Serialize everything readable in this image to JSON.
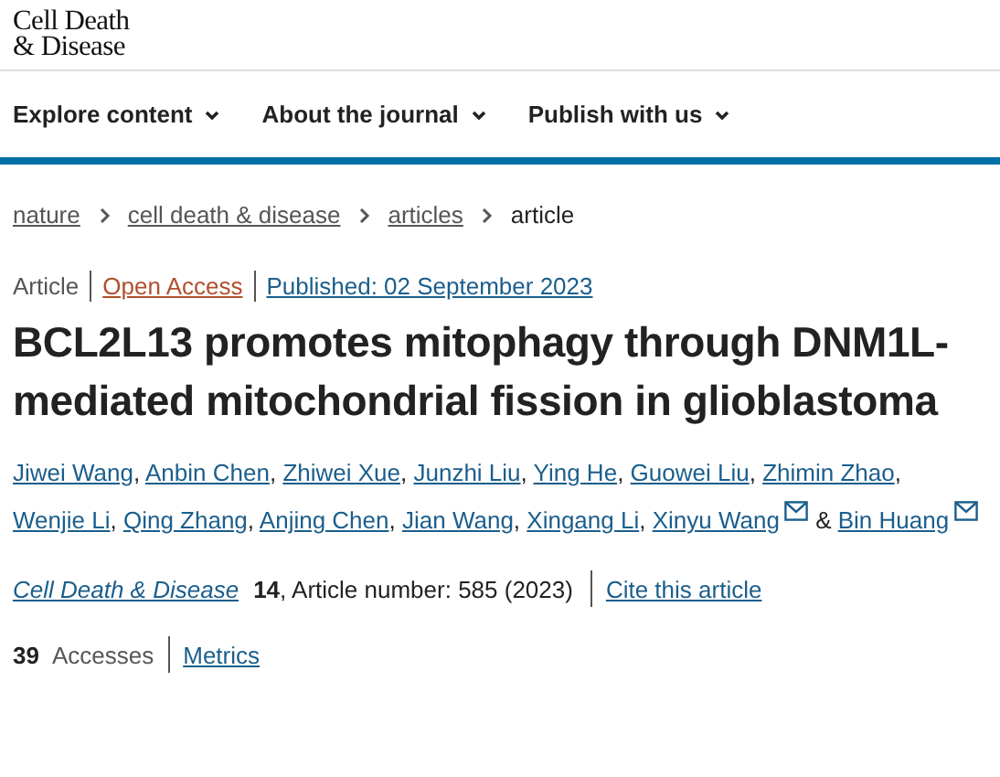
{
  "logo": {
    "line_1": "Cell Death",
    "line_2": "& Disease"
  },
  "nav": [
    {
      "label": "Explore content"
    },
    {
      "label": "About the journal"
    },
    {
      "label": "Publish with us"
    }
  ],
  "breadcrumbs": [
    {
      "label": "nature",
      "link": true
    },
    {
      "label": "cell death & disease",
      "link": true
    },
    {
      "label": "articles",
      "link": true
    },
    {
      "label": "article",
      "link": false
    }
  ],
  "meta": [
    {
      "kind": "type",
      "text": "Article"
    },
    {
      "kind": "access",
      "text": "Open Access"
    },
    {
      "kind": "date",
      "text": "Published: 02 September 2023"
    }
  ],
  "title": "BCL2L13 promotes mitophagy through DNM1L-mediated mitochondrial fission in glioblastoma",
  "authors": [
    {
      "name": "Jiwei Wang",
      "mail": false
    },
    {
      "name": "Anbin Chen",
      "mail": false
    },
    {
      "name": "Zhiwei Xue",
      "mail": false
    },
    {
      "name": "Junzhi Liu",
      "mail": false
    },
    {
      "name": "Ying He",
      "mail": false
    },
    {
      "name": "Guowei Liu",
      "mail": false
    },
    {
      "name": "Zhimin Zhao",
      "mail": false
    },
    {
      "name": "Wenjie Li",
      "mail": false
    },
    {
      "name": "Qing Zhang",
      "mail": false
    },
    {
      "name": "Anjing Chen",
      "mail": false
    },
    {
      "name": "Jian Wang",
      "mail": false
    },
    {
      "name": "Xingang Li",
      "mail": false
    },
    {
      "name": "Xinyu Wang",
      "mail": true
    },
    {
      "name": "Bin Huang",
      "mail": true
    }
  ],
  "authors_separator": ",",
  "authors_conjunction": "&",
  "citation": {
    "journal": "Cell Death & Disease",
    "volume": "14",
    "details": ", Article number: 585 (2023)",
    "cite_link": "Cite this article"
  },
  "metrics": {
    "count": "39",
    "label": "Accesses",
    "link": "Metrics"
  }
}
